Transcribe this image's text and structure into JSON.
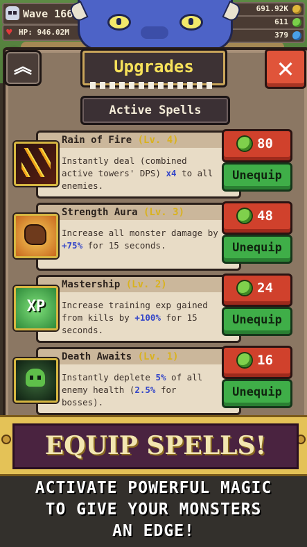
{
  "hud": {
    "wave": "Wave 166",
    "hp": "HP: 946.02M",
    "gold": "691.92K",
    "gems": "611",
    "orbs": "379"
  },
  "panel": {
    "title": "Upgrades",
    "section": "Active Spells",
    "up_icon": "chevron-up-icon",
    "close_icon": "close-icon",
    "up_label": "︽",
    "close_label": "✕"
  },
  "spells": [
    {
      "icon": "rain-of-fire-icon",
      "name": "Rain of Fire",
      "level": "(Lv. 4)",
      "desc_pre": "Instantly deal (combined active towers' DPS) ",
      "desc_hl": "x4",
      "desc_post": " to all enemies.",
      "cost": "80",
      "action": "Unequip"
    },
    {
      "icon": "strength-aura-icon",
      "name": "Strength Aura",
      "level": "(Lv. 3)",
      "desc_pre": "Increase all monster damage by ",
      "desc_hl": "+75%",
      "desc_post": " for 15 seconds.",
      "cost": "48",
      "action": "Unequip"
    },
    {
      "icon": "xp-icon",
      "icon_text": "XP",
      "name": "Mastership",
      "level": "(Lv. 2)",
      "desc_pre": "Increase training exp gained from kills by ",
      "desc_hl": "+100%",
      "desc_post": " for 15 seconds.",
      "cost": "24",
      "action": "Unequip"
    },
    {
      "icon": "skull-icon",
      "name": "Death Awaits",
      "level": "(Lv. 1)",
      "desc_pre": "Instantly deplete ",
      "desc_hl": "5%",
      "desc_mid": " of all enemy health (",
      "desc_hl2": "2.5%",
      "desc_post": " for bosses).",
      "cost": "16",
      "action": "Unequip"
    }
  ],
  "promo": {
    "banner": "EQUIP SPELLS!",
    "line1": "ACTIVATE POWERFUL MAGIC",
    "line2": "TO GIVE YOUR MONSTERS",
    "line3": "AN EDGE!"
  }
}
